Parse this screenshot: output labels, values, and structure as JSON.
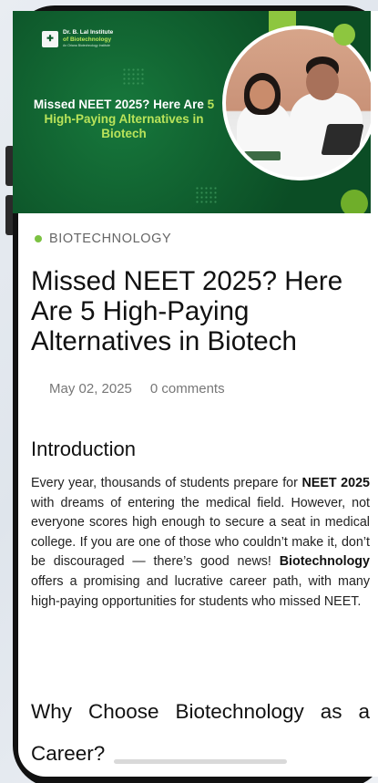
{
  "hero": {
    "logo_line1": "Dr. B. Lal Institute",
    "logo_line2": "of Biotechnology",
    "logo_line3": "An Oriana Biotechnology Institute",
    "title_part1": "Missed NEET 2025? Here Are ",
    "title_highlight": "5 High-Paying Alternatives in Biotech",
    "accent_color": "#b9e35a",
    "background_color": "#0d5a2c"
  },
  "article": {
    "category": "BIOTECHNOLOGY",
    "title": "Missed NEET 2025? Here Are 5 High-Paying Alternatives in Biotech",
    "date": "May 02, 2025",
    "comments": "0 comments",
    "section1_heading": "Introduction",
    "para_1": "Every year, thousands of students prepare for ",
    "para_bold_1": "NEET 2025",
    "para_2": " with dreams of entering the medical field. However, not everyone scores high enough to secure a seat in medical college. If you are one of those who couldn’t make it, don’t be discouraged — there’s good news! ",
    "para_bold_2": "Biotechnology",
    "para_3": " offers a promising and lucrative career path, with many high-paying opportunities for students who missed NEET.",
    "section2_heading": "Why Choose Biotechnology as a Career?"
  }
}
